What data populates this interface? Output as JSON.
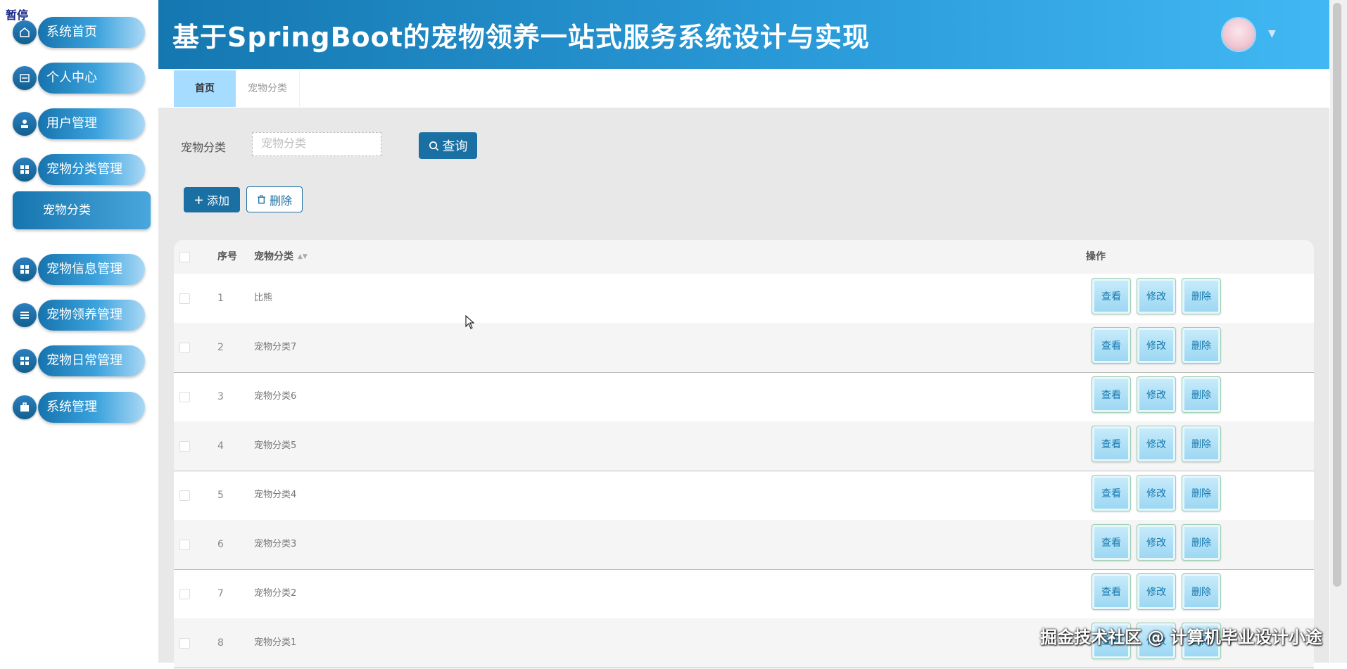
{
  "overlay": {
    "pause_label": "暂停",
    "watermark": "掘金技术社区 @ 计算机毕业设计小途"
  },
  "header": {
    "title": "基于SpringBoot的宠物领养一站式服务系统设计与实现",
    "caret": "▼"
  },
  "sidebar": {
    "items": [
      {
        "label": "系统首页",
        "icon": "home-icon"
      },
      {
        "label": "个人中心",
        "icon": "id-card-icon"
      },
      {
        "label": "用户管理",
        "icon": "user-icon"
      },
      {
        "label": "宠物分类管理",
        "icon": "grid-icon"
      },
      {
        "label": "宠物信息管理",
        "icon": "grid-icon"
      },
      {
        "label": "宠物领养管理",
        "icon": "list-icon"
      },
      {
        "label": "宠物日常管理",
        "icon": "grid-icon"
      },
      {
        "label": "系统管理",
        "icon": "briefcase-icon"
      }
    ],
    "sub_item": {
      "label": "宠物分类"
    }
  },
  "tabs": [
    {
      "label": "首页"
    },
    {
      "label": "宠物分类"
    }
  ],
  "search": {
    "label": "宠物分类",
    "placeholder": "宠物分类",
    "value": "",
    "button_label": "查询"
  },
  "toolbar": {
    "add_label": "添加",
    "delete_label": "删除"
  },
  "table": {
    "headers": {
      "index": "序号",
      "name": "宠物分类",
      "actions": "操作"
    },
    "action_labels": {
      "view": "查看",
      "edit": "修改",
      "delete": "删除"
    },
    "rows": [
      {
        "index": "1",
        "name": "比熊"
      },
      {
        "index": "2",
        "name": "宠物分类7"
      },
      {
        "index": "3",
        "name": "宠物分类6"
      },
      {
        "index": "4",
        "name": "宠物分类5"
      },
      {
        "index": "5",
        "name": "宠物分类4"
      },
      {
        "index": "6",
        "name": "宠物分类3"
      },
      {
        "index": "7",
        "name": "宠物分类2"
      },
      {
        "index": "8",
        "name": "宠物分类1"
      }
    ]
  },
  "colors": {
    "primary": "#1a6fa3",
    "header_start": "#1577b0",
    "header_end": "#41b8f3",
    "active_tab": "#a6dcff",
    "content_bg": "#e8e8e8"
  }
}
